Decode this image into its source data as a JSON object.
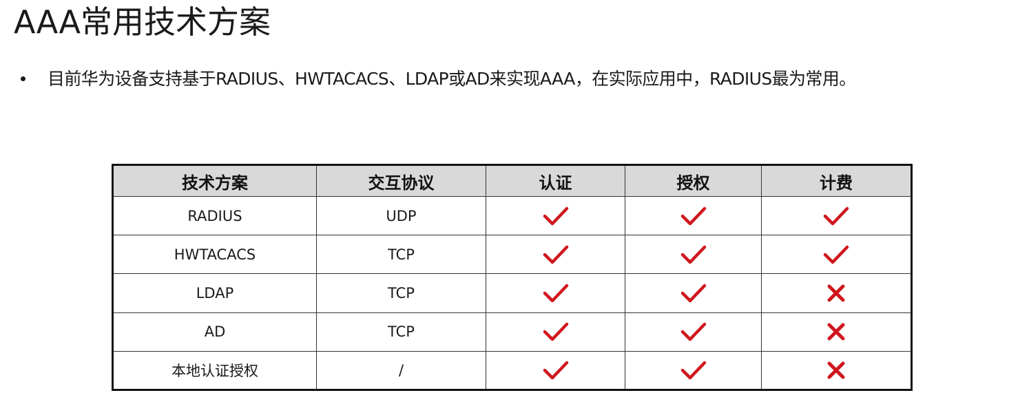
{
  "page": {
    "title": "AAA常用技术方案",
    "bullet": "目前华为设备支持基于RADIUS、HWTACACS、LDAP或AD来实现AAA，在实际应用中，RADIUS最为常用。"
  },
  "table": {
    "headers": [
      "技术方案",
      "交互协议",
      "认证",
      "授权",
      "计费"
    ],
    "rows": [
      {
        "scheme": "RADIUS",
        "protocol": "UDP",
        "auth": true,
        "authz": true,
        "acct": true
      },
      {
        "scheme": "HWTACACS",
        "protocol": "TCP",
        "auth": true,
        "authz": true,
        "acct": true
      },
      {
        "scheme": "LDAP",
        "protocol": "TCP",
        "auth": true,
        "authz": true,
        "acct": false
      },
      {
        "scheme": "AD",
        "protocol": "TCP",
        "auth": true,
        "authz": true,
        "acct": false
      },
      {
        "scheme": "本地认证授权",
        "protocol": "/",
        "auth": true,
        "authz": true,
        "acct": false
      }
    ]
  },
  "icons": {
    "supported": "check-icon",
    "unsupported": "cross-icon"
  },
  "colors": {
    "mark": "#d0161e",
    "header_bg": "#d9d9d9"
  }
}
